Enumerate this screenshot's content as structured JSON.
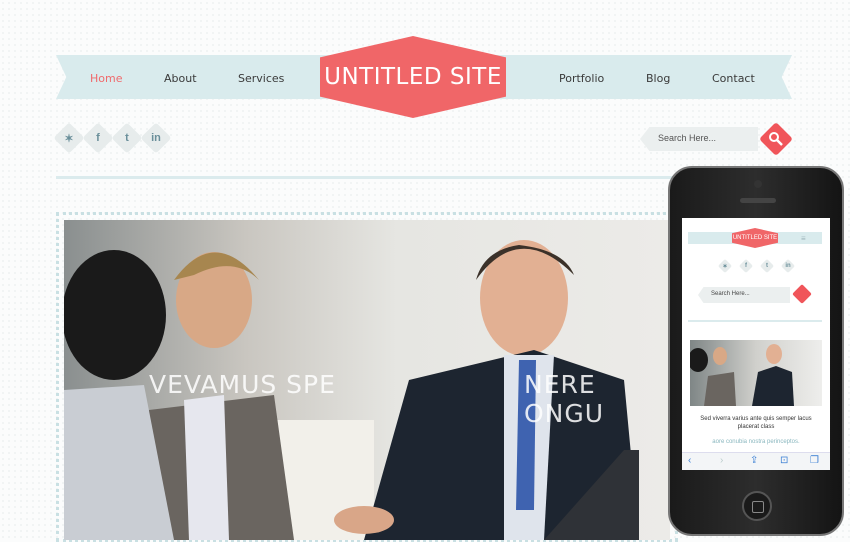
{
  "nav": {
    "items": [
      {
        "label": "Home",
        "active": true
      },
      {
        "label": "About"
      },
      {
        "label": "Services"
      },
      {
        "label": "Portfolio"
      },
      {
        "label": "Blog"
      },
      {
        "label": "Contact"
      }
    ]
  },
  "logo": {
    "text": "UNTITLED SITE"
  },
  "social": {
    "icons": [
      "user-icon",
      "facebook-icon",
      "twitter-icon",
      "linkedin-icon"
    ],
    "glyphs": [
      "✶",
      "f",
      "t",
      "in"
    ]
  },
  "search": {
    "placeholder": "Search Here..."
  },
  "hero": {
    "caption_left": "VEVAMUS SPE",
    "caption_right": "NERE ONGU"
  },
  "mobile": {
    "logo": "UNTITLED SITE",
    "menu_icon": "≡",
    "search_placeholder": "Search Here...",
    "text_line1": "Sed viverra varius ante quis semper lacus",
    "text_line2": "placerat class",
    "text_line3": "aore conubia nostra perinceptos.",
    "toolbar": [
      "‹",
      "›",
      "⇪",
      "⊡",
      "❐"
    ]
  },
  "colors": {
    "accent": "#f06668",
    "ribbon": "#d9ebed",
    "nav_active": "#f06a6c"
  }
}
